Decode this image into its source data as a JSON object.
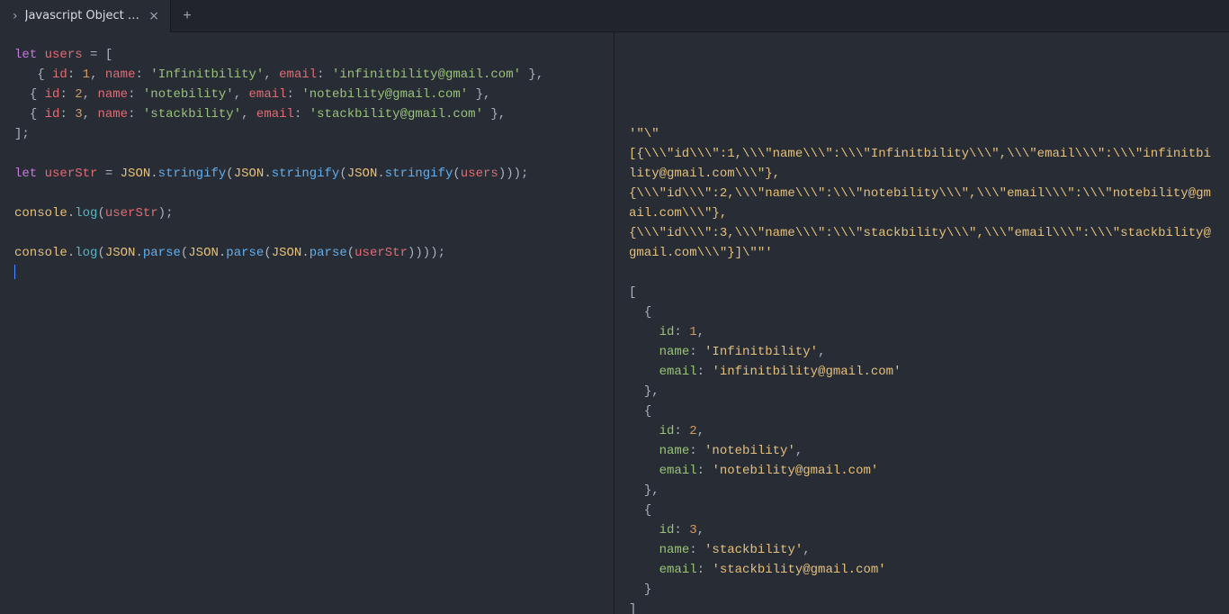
{
  "tab": {
    "title": "Javascript Object - arra...",
    "prefix": "›",
    "close": "×",
    "newTab": "+"
  },
  "code": {
    "let": "let",
    "users": "users",
    "eq": " = ",
    "ob": "[",
    "cb": "]",
    "oc": "{",
    "cc": "}",
    "semi": ";",
    "comma": ",",
    "colon": ":",
    "sp": " ",
    "id": "id",
    "name": "name",
    "email": "email",
    "v1id": "1",
    "v1name": "'Infinitbility'",
    "v1email": "'infinitbility@gmail.com'",
    "v2id": "2",
    "v2name": "'notebility'",
    "v2email": "'notebility@gmail.com'",
    "v3id": "3",
    "v3name": "'stackbility'",
    "v3email": "'stackbility@gmail.com'",
    "userStr": "userStr",
    "JSON": "JSON",
    "stringify": "stringify",
    "parse": "parse",
    "console": "console",
    "log": "log",
    "op": "(",
    "cp": ")",
    "dot": "."
  },
  "out": {
    "line1": "'\"\\\"",
    "line2": "[{\\\\\\\"id\\\\\\\":1,\\\\\\\"name\\\\\\\":\\\\\\\"Infinitbility\\\\\\\",\\\\\\\"email\\\\\\\":\\\\\\\"infinitbility@gmail.com\\\\\\\"},",
    "line3": "{\\\\\\\"id\\\\\\\":2,\\\\\\\"name\\\\\\\":\\\\\\\"notebility\\\\\\\",\\\\\\\"email\\\\\\\":\\\\\\\"notebility@gmail.com\\\\\\\"},",
    "line4": "{\\\\\\\"id\\\\\\\":3,\\\\\\\"name\\\\\\\":\\\\\\\"stackbility\\\\\\\",\\\\\\\"email\\\\\\\":\\\\\\\"stackbility@gmail.com\\\\\\\"}]\\\"\"'",
    "arrOpen": "[",
    "arrClose": "]",
    "objOpen": "{",
    "objClose": "}",
    "comma": ",",
    "colon": ": ",
    "kId": "id",
    "kName": "name",
    "kEmail": "email",
    "o1id": "1",
    "o1name": "'Infinitbility'",
    "o1email": "'infinitbility@gmail.com'",
    "o2id": "2",
    "o2name": "'notebility'",
    "o2email": "'notebility@gmail.com'",
    "o3id": "3",
    "o3name": "'stackbility'",
    "o3email": "'stackbility@gmail.com'"
  }
}
